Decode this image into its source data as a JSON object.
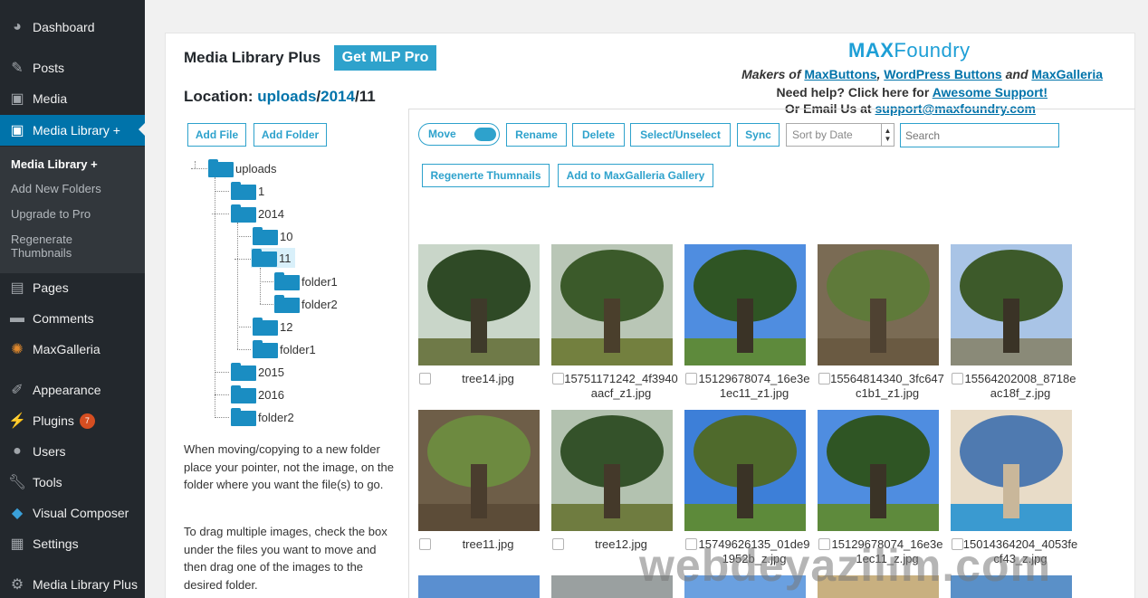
{
  "sidebar": {
    "items": [
      {
        "label": "Dashboard",
        "icon": "dashboard-icon"
      },
      {
        "label": "Posts",
        "icon": "pin-icon"
      },
      {
        "label": "Media",
        "icon": "media-icon"
      },
      {
        "label": "Media Library +",
        "icon": "media-icon"
      },
      {
        "label": "Pages",
        "icon": "pages-icon"
      },
      {
        "label": "Comments",
        "icon": "comment-icon"
      },
      {
        "label": "MaxGalleria",
        "icon": "gallery-icon"
      },
      {
        "label": "Appearance",
        "icon": "brush-icon"
      },
      {
        "label": "Plugins",
        "icon": "plugin-icon",
        "badge": "7"
      },
      {
        "label": "Users",
        "icon": "user-icon"
      },
      {
        "label": "Tools",
        "icon": "wrench-icon"
      },
      {
        "label": "Visual Composer",
        "icon": "vc-icon"
      },
      {
        "label": "Settings",
        "icon": "settings-icon"
      },
      {
        "label": "Media Library Plus",
        "icon": "gear-icon"
      }
    ],
    "submenu": [
      "Media Library +",
      "Add New Folders",
      "Upgrade to Pro",
      "Regenerate Thumbnails"
    ]
  },
  "header": {
    "title": "Media Library Plus",
    "pro_button": "Get MLP Pro",
    "logo_max": "MAX",
    "logo_foundry": "Foundry",
    "makers_prefix": "Makers of ",
    "makers_link1": "MaxButtons",
    "makers_sep1": ", ",
    "makers_link2": "WordPress Buttons",
    "makers_sep2": " and ",
    "makers_link3": "MaxGalleria",
    "help_prefix": "Need help? Click here for ",
    "help_link": "Awesome Support!",
    "email_prefix": "Or Email Us at ",
    "email_link": "support@maxfoundry.com"
  },
  "location": {
    "label": "Location:",
    "p1": "uploads",
    "sep1": "/",
    "p2": "2014",
    "sep2": "/",
    "p3": "11"
  },
  "left_buttons": {
    "add_file": "Add File",
    "add_folder": "Add Folder"
  },
  "tree": [
    "uploads",
    "1",
    "2014",
    "10",
    "11",
    "folder1",
    "folder2",
    "12",
    "folder1",
    "2015",
    "2016",
    "folder2"
  ],
  "help_text": [
    "When moving/copying to a new folder place your pointer, not the image, on the folder where you want the file(s) to go.",
    "To drag multiple images, check the box under the files you want to move and then drag one of the images to the desired folder."
  ],
  "toolbar": {
    "move_toggle": "Move",
    "rename": "Rename",
    "delete": "Delete",
    "select_unselect": "Select/Unselect",
    "sync": "Sync",
    "sort_select": "Sort by Date",
    "search_placeholder": "Search",
    "regenerate": "Regenerte Thumnails",
    "add_gallery": "Add to MaxGalleria Gallery"
  },
  "files": [
    {
      "name": "tree14.jpg",
      "sky": "#c9d6c9",
      "grass": "#6f7a48",
      "canopy": "#2f4a26",
      "trunk": "#3e3a2a"
    },
    {
      "name": "15751171242_4f3940aacf_z1.jpg",
      "sky": "#b9c6b6",
      "grass": "#73803f",
      "canopy": "#3b5a2a",
      "trunk": "#4a3f2c"
    },
    {
      "name": "15129678074_16e3e1ec11_z1.jpg",
      "sky": "#4f8de0",
      "grass": "#5e8a3c",
      "canopy": "#2f5524",
      "trunk": "#3a3326"
    },
    {
      "name": "15564814340_3fc647c1b1_z1.jpg",
      "sky": "#7a6b54",
      "grass": "#6a5a42",
      "canopy": "#5f7a3a",
      "trunk": "#4f4232"
    },
    {
      "name": "15564202008_8718eac18f_z.jpg",
      "sky": "#a9c4e6",
      "grass": "#8a8a78",
      "canopy": "#3d5a2a",
      "trunk": "#3a3326"
    },
    {
      "name": "tree11.jpg",
      "sky": "#6e5e48",
      "grass": "#5c4c38",
      "canopy": "#6d8a40",
      "trunk": "#4a3d2e"
    },
    {
      "name": "tree12.jpg",
      "sky": "#b3c2b0",
      "grass": "#6f7c40",
      "canopy": "#34522a",
      "trunk": "#44392a"
    },
    {
      "name": "15749626135_01de91952b_z.jpg",
      "sky": "#3d7fd8",
      "grass": "#5d8a3a",
      "canopy": "#4f6a2c",
      "trunk": "#3a3326"
    },
    {
      "name": "15129678074_16e3e1ec11_z.jpg",
      "sky": "#4f8de0",
      "grass": "#5e8a3c",
      "canopy": "#2f5524",
      "trunk": "#3a3326"
    },
    {
      "name": "15014364204_4053fecf43_z.jpg",
      "sky": "#e8dcc8",
      "grass": "#3a9ad0",
      "canopy": "#4f7ab0",
      "trunk": "#c9b79a"
    }
  ],
  "watermark": "webdeyazilim.com"
}
